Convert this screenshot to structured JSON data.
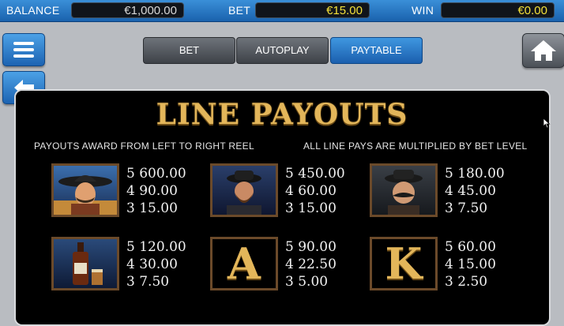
{
  "topbar": {
    "balance_label": "BALANCE",
    "balance_value": "€1,000.00",
    "bet_label": "BET",
    "bet_value": "€15.00",
    "win_label": "WIN",
    "win_value": "€0.00",
    "colors": {
      "balance": "#d8d8d8",
      "bet": "#f3e03a",
      "win": "#f3e03a"
    }
  },
  "tabs": [
    {
      "label": "BET",
      "active": false
    },
    {
      "label": "AUTOPLAY",
      "active": false
    },
    {
      "label": "PAYTABLE",
      "active": true
    }
  ],
  "paytable": {
    "title": "LINE PAYOUTS",
    "left_note": "PAYOUTS AWARD FROM LEFT TO RIGHT REEL",
    "right_note": "ALL LINE PAYS ARE MULTIPLIED BY BET LEVEL",
    "symbols": [
      {
        "icon": "cowboy-sombrero-icon",
        "pays": [
          "5 600.00",
          "4 90.00",
          "3 15.00"
        ]
      },
      {
        "icon": "bearded-outlaw-icon",
        "pays": [
          "5 450.00",
          "4 60.00",
          "3 15.00"
        ]
      },
      {
        "icon": "mustache-sheriff-icon",
        "pays": [
          "5 180.00",
          "4 45.00",
          "3 7.50"
        ]
      },
      {
        "icon": "whiskey-bottle-icon",
        "pays": [
          "5 120.00",
          "4 30.00",
          "3 7.50"
        ]
      },
      {
        "icon": "letter-a-icon",
        "letter": "A",
        "pays": [
          "5 90.00",
          "4 22.50",
          "3 5.00"
        ]
      },
      {
        "icon": "letter-k-icon",
        "letter": "K",
        "pays": [
          "5 60.00",
          "4 15.00",
          "3 2.50"
        ]
      }
    ]
  }
}
